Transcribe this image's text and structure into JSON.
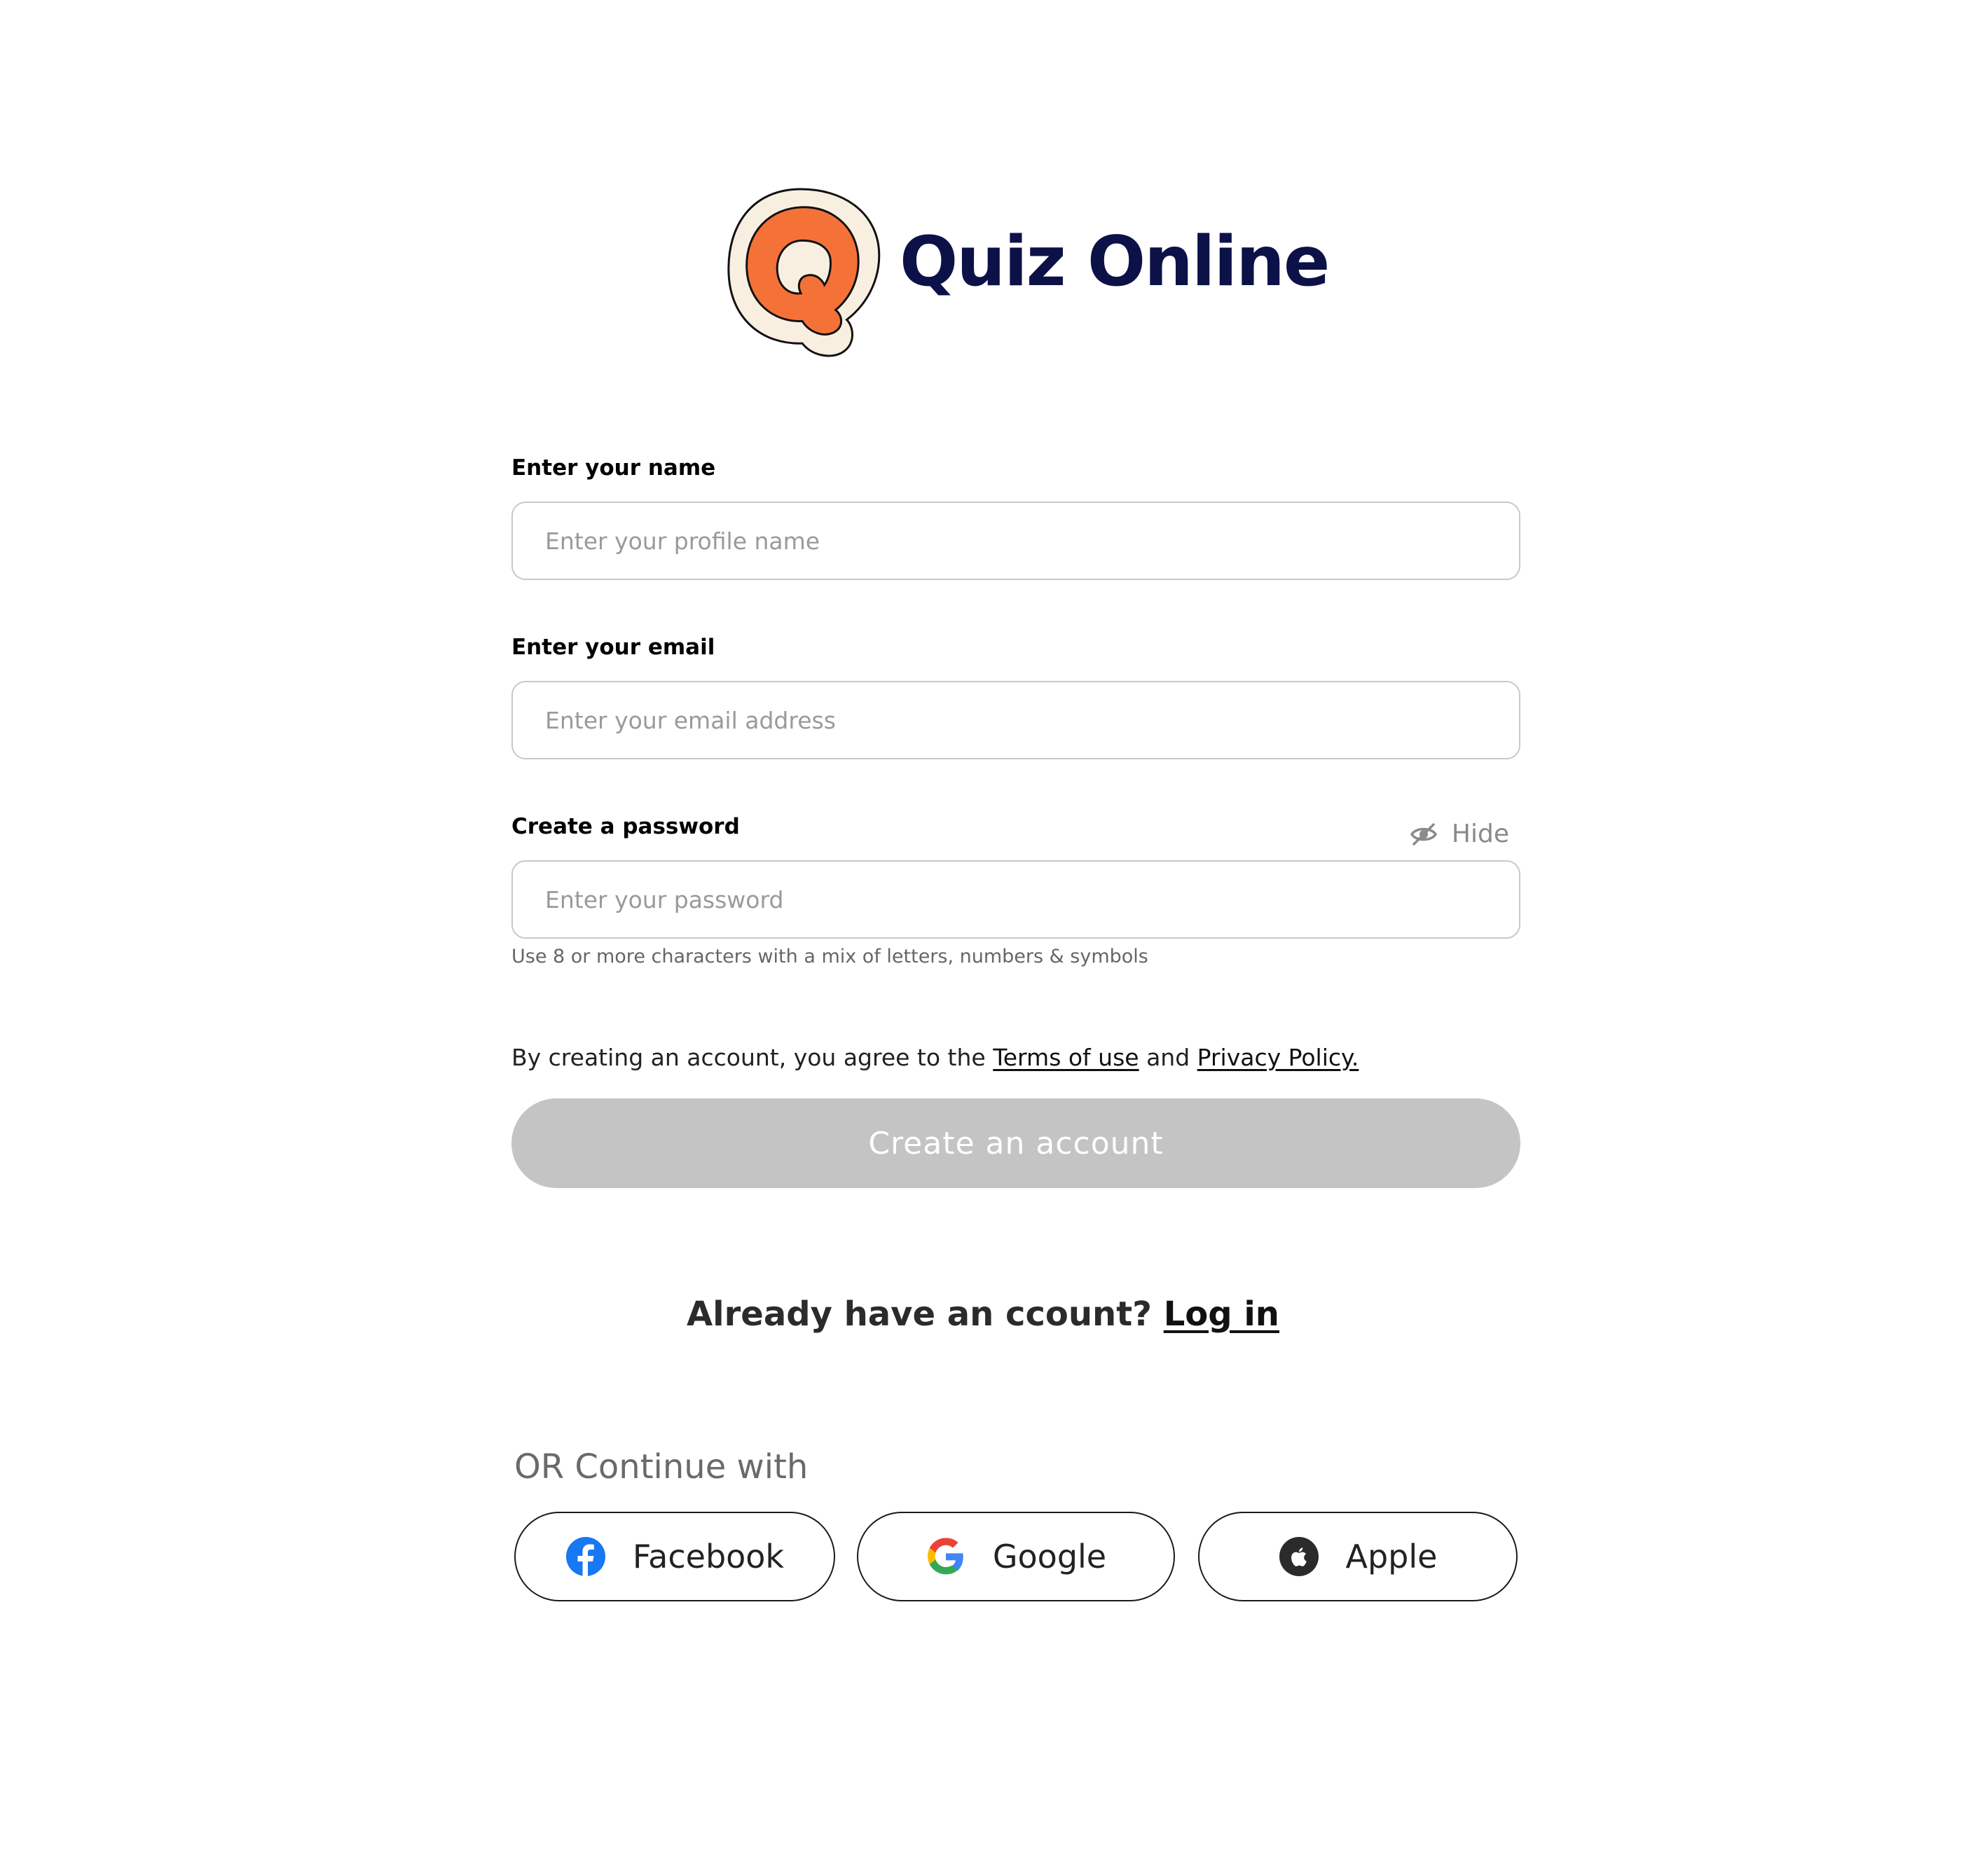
{
  "brand": {
    "title": "Quiz Online",
    "logo_letter": "Q",
    "logo_colors": {
      "fill": "#f47238",
      "cream": "#f9efe1",
      "outline": "#111111"
    },
    "title_color": "#0c1148"
  },
  "form": {
    "name": {
      "label": "Enter your name",
      "placeholder": "Enter your profile name",
      "value": ""
    },
    "email": {
      "label": "Enter your email",
      "placeholder": "Enter your email address",
      "value": ""
    },
    "password": {
      "label": "Create a password",
      "placeholder": "Enter your password",
      "value": "",
      "toggle_icon": "eye-off-icon",
      "toggle_label": "Hide",
      "hint": "Use 8 or more characters with a mix of letters, numbers & symbols"
    },
    "terms": {
      "prefix": "By creating an account, you agree to the ",
      "terms_link": "Terms of use",
      "middle": " and ",
      "privacy_link": "Privacy Policy."
    },
    "submit_label": "Create an account",
    "submit_color": "#c4c4c4"
  },
  "login": {
    "prompt": "Already have an ccount? ",
    "link": "Log in"
  },
  "social": {
    "heading": "OR Continue with",
    "buttons": [
      {
        "label": "Facebook",
        "icon": "facebook-icon",
        "color": "#1877f2"
      },
      {
        "label": "Google",
        "icon": "google-icon",
        "color": "#4285f4"
      },
      {
        "label": "Apple",
        "icon": "apple-icon",
        "color": "#2b2b2b"
      }
    ]
  }
}
